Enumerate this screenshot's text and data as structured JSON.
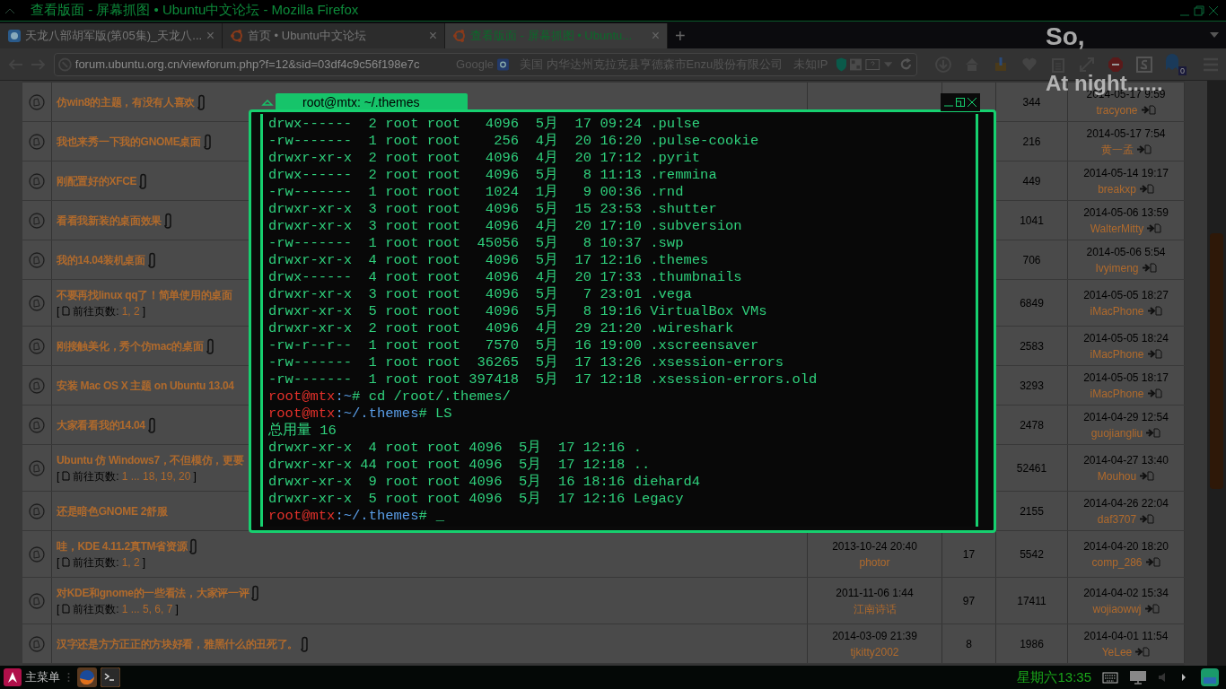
{
  "window": {
    "title": "查看版面 - 屏幕抓图 • Ubuntu中文论坛 - Mozilla Firefox"
  },
  "tabs": [
    {
      "title": "天龙八部胡军版(第05集)_天龙八...",
      "close": "×",
      "selected": false,
      "kind": "video"
    },
    {
      "title": "首页 • Ubuntu中文论坛",
      "close": "×",
      "selected": false,
      "kind": "ubuntu"
    },
    {
      "title": "查看版面 - 屏幕抓图 • Ubuntu...",
      "close": "×",
      "selected": true,
      "kind": "ubuntu"
    }
  ],
  "new_tab": "+",
  "navbar": {
    "url": "forum.ubuntu.org.cn/viewforum.php?f=12&sid=03df4c9c56f198e7c",
    "search_engine": "Google",
    "location": "美国 内华达州克拉克县亨德森市Enzu股份有限公司",
    "ip": "未知IP",
    "badge": "0"
  },
  "overlay_text": [
    "So,",
    "At night......"
  ],
  "topics": [
    {
      "title": "仿win8的主题，有没有人喜欢",
      "attachment": true,
      "views": "344",
      "last_date": "2014-05-17 9:59",
      "last_author": "tracyone"
    },
    {
      "title": "我也来秀一下我的GNOME桌面",
      "attachment": true,
      "views": "216",
      "last_date": "2014-05-17 7:54",
      "last_author": "黄一孟"
    },
    {
      "title": "刚配置好的XFCE",
      "attachment": true,
      "views": "449",
      "last_date": "2014-05-14 19:17",
      "last_author": "breakxp"
    },
    {
      "title": "看看我新装的桌面效果",
      "attachment": true,
      "views": "1041",
      "last_date": "2014-05-06 13:59",
      "last_author": "WalterMitty"
    },
    {
      "title": "我的14.04装机桌面",
      "attachment": true,
      "views": "706",
      "last_date": "2014-05-06 5:54",
      "last_author": "Ivyimeng"
    },
    {
      "title": "不要再找linux qq了！简单使用的桌面",
      "attachment": false,
      "pages": {
        "open": "[",
        "label": "前往页数:",
        "links": "1, 2",
        "close": "]"
      },
      "views": "6849",
      "last_date": "2014-05-05 18:27",
      "last_author": "iMacPhone"
    },
    {
      "title": "刚接触美化，秀个仿mac的桌面",
      "attachment": true,
      "views": "2583",
      "last_date": "2014-05-05 18:24",
      "last_author": "iMacPhone"
    },
    {
      "title": "安装 Mac OS X 主题 on Ubuntu 13.04",
      "attachment": false,
      "views": "3293",
      "last_date": "2014-05-05 18:17",
      "last_author": "iMacPhone"
    },
    {
      "title": "大家看看我的14.04",
      "attachment": true,
      "views": "2478",
      "last_date": "2014-04-29 12:54",
      "last_author": "guojiangliu"
    },
    {
      "title": "Ubuntu 仿 Windows7，不但模仿，更要",
      "attachment": false,
      "pages": {
        "open": "[",
        "label": "前往页数:",
        "links": "1 ... 18, 19, 20",
        "close": "]"
      },
      "views": "52461",
      "last_date": "2014-04-27 13:40",
      "last_author": "Mouhou"
    },
    {
      "title": "还是暗色GNOME 2舒服",
      "attachment": false,
      "views": "2155",
      "last_date": "2014-04-26 22:04",
      "last_author": "daf3707"
    },
    {
      "title": "哇，KDE 4.11.2真TM省资源",
      "attachment": true,
      "pages": {
        "open": "[",
        "label": "前往页数:",
        "links": "1, 2",
        "close": "]"
      },
      "first_date": "2013-10-24 20:40",
      "first_author": "photor",
      "replies": "17",
      "views": "5542",
      "last_date": "2014-04-20 18:20",
      "last_author": "comp_286"
    },
    {
      "title": "对KDE和gnome的一些看法，大家评一评",
      "attachment": true,
      "pages": {
        "open": "[",
        "label": "前往页数:",
        "links": "1 ... 5, 6, 7",
        "close": "]"
      },
      "first_date": "2011-11-06 1:44",
      "first_author": "江南诗话",
      "replies": "97",
      "views": "17411",
      "last_date": "2014-04-02 15:34",
      "last_author": "wojiaowwj"
    },
    {
      "title": "汉字还是方方正正的方块好看，雅黑什么的丑死了。",
      "attachment": true,
      "first_date": "2014-03-09 21:39",
      "first_author": "tjkitty2002",
      "replies": "8",
      "views": "1986",
      "last_date": "2014-04-01 11:54",
      "last_author": "YeLee"
    }
  ],
  "terminal": {
    "title": "root@mtx: ~/.themes",
    "lines": [
      {
        "kind": "output",
        "text": "drwx------  2 root root   4096  5月  17 09:24 .pulse"
      },
      {
        "kind": "output",
        "text": "-rw-------  1 root root    256  4月  20 16:20 .pulse-cookie"
      },
      {
        "kind": "output",
        "text": "drwxr-xr-x  2 root root   4096  4月  20 17:12 .pyrit"
      },
      {
        "kind": "output",
        "text": "drwx------  2 root root   4096  5月   8 11:13 .remmina"
      },
      {
        "kind": "output",
        "text": "-rw-------  1 root root   1024  1月   9 00:36 .rnd"
      },
      {
        "kind": "output",
        "text": "drwxr-xr-x  3 root root   4096  5月  15 23:53 .shutter"
      },
      {
        "kind": "output",
        "text": "drwxr-xr-x  3 root root   4096  4月  20 17:10 .subversion"
      },
      {
        "kind": "output",
        "text": "-rw-------  1 root root  45056  5月   8 10:37 .swp"
      },
      {
        "kind": "output",
        "text": "drwxr-xr-x  4 root root   4096  5月  17 12:16 .themes"
      },
      {
        "kind": "output",
        "text": "drwx------  4 root root   4096  4月  20 17:33 .thumbnails"
      },
      {
        "kind": "output",
        "text": "drwxr-xr-x  3 root root   4096  5月   7 23:01 .vega"
      },
      {
        "kind": "output",
        "text": "drwxr-xr-x  5 root root   4096  5月   8 19:16 VirtualBox VMs"
      },
      {
        "kind": "output",
        "text": "drwxr-xr-x  2 root root   4096  4月  29 21:20 .wireshark"
      },
      {
        "kind": "output",
        "text": "-rw-r--r--  1 root root   7570  5月  16 19:00 .xscreensaver"
      },
      {
        "kind": "output",
        "text": "-rw-------  1 root root  36265  5月  17 13:26 .xsession-errors"
      },
      {
        "kind": "output",
        "text": "-rw-------  1 root root 397418  5月  17 12:18 .xsession-errors.old"
      },
      {
        "kind": "prompt",
        "user": "root@mtx",
        "path": ":~",
        "command": "# cd /root/.themes/"
      },
      {
        "kind": "prompt",
        "user": "root@mtx",
        "path": ":~/.themes",
        "command": "# LS"
      },
      {
        "kind": "output",
        "text": "总用量 16"
      },
      {
        "kind": "output",
        "text": "drwxr-xr-x  4 root root 4096  5月  17 12:16 ."
      },
      {
        "kind": "output",
        "text": "drwxr-xr-x 44 root root 4096  5月  17 12:18 .."
      },
      {
        "kind": "output",
        "text": "drwxr-xr-x  9 root root 4096  5月  16 18:16 diehard4"
      },
      {
        "kind": "output",
        "text": "drwxr-xr-x  5 root root 4096  5月  17 12:16 Legacy"
      },
      {
        "kind": "prompt",
        "user": "root@mtx",
        "path": ":~/.themes",
        "command": "#",
        "cursor": "_"
      }
    ]
  },
  "taskbar": {
    "menu": "主菜单",
    "clock": "星期六13:35"
  }
}
